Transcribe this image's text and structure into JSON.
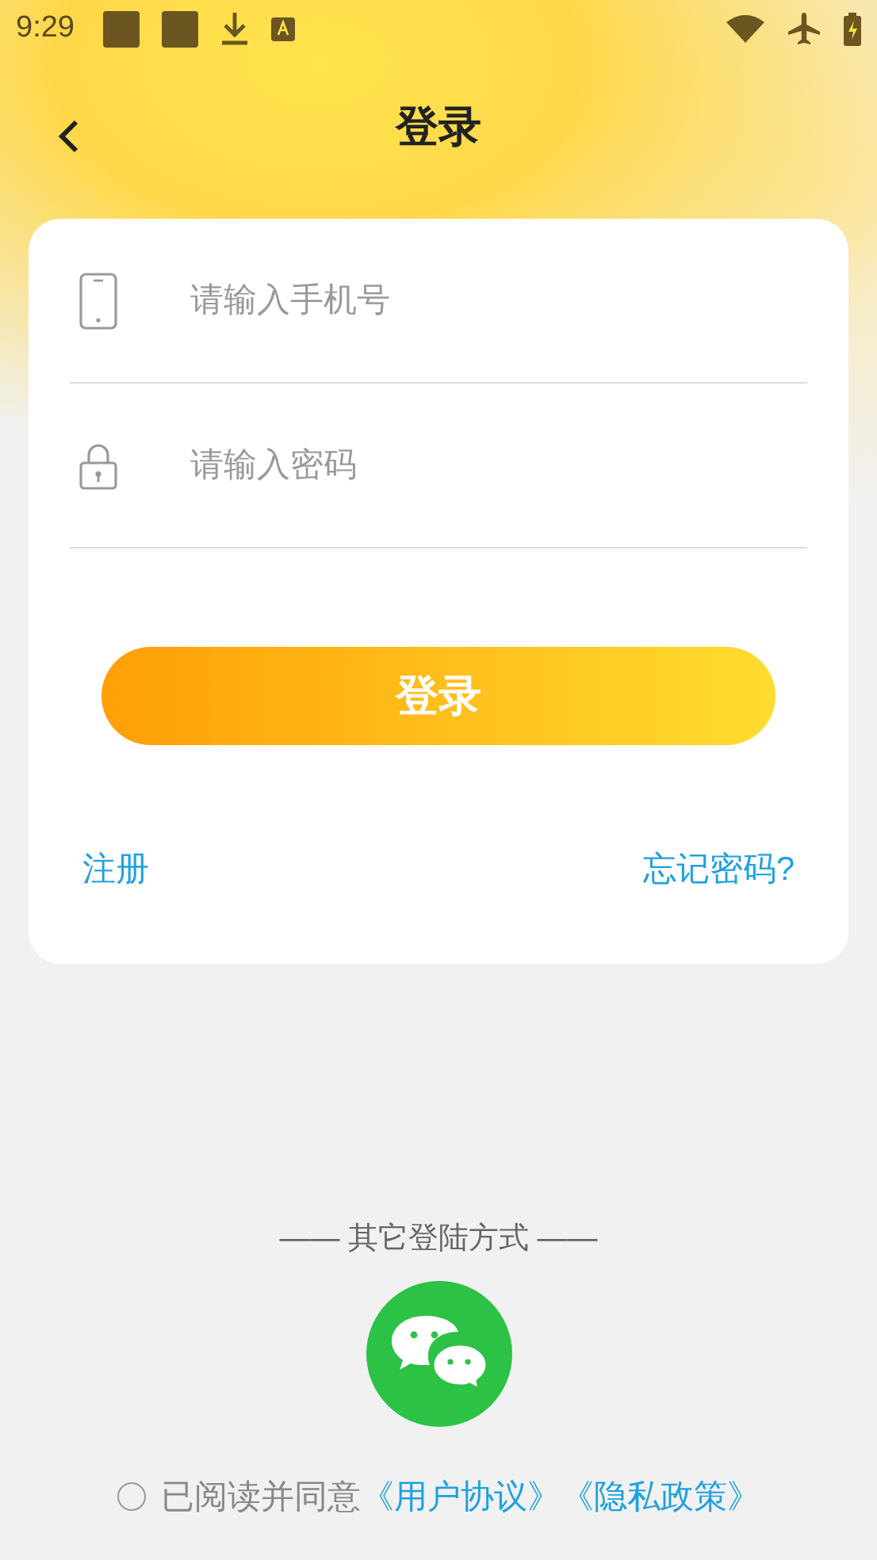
{
  "status_bar": {
    "time": "9:29"
  },
  "header": {
    "title": "登录"
  },
  "fields": [
    {
      "kind": "phone",
      "placeholder": "请输入手机号"
    },
    {
      "kind": "lock",
      "placeholder": "请输入密码"
    }
  ],
  "login_button": "登录",
  "links": {
    "register": "注册",
    "forgot": "忘记密码?"
  },
  "other_login": {
    "label": "—— 其它登陆方式 ——"
  },
  "agreement": {
    "checked": false,
    "text": "已阅读并同意",
    "links": [
      "《用户协议》",
      "《隐私政策》"
    ]
  }
}
